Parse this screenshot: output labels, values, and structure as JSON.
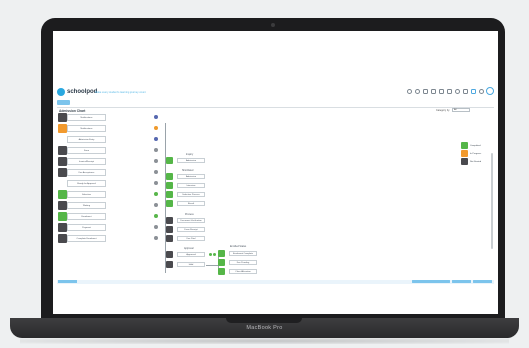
{
  "device": {
    "label": "MacBook Pro"
  },
  "app": {
    "name": "schoolpod",
    "tagline": "Make every student's learning journey count"
  },
  "panel": {
    "title": "Admission Chart",
    "filter_label": "Category by",
    "filter_value": "All"
  },
  "left_column": [
    {
      "label": "Notifications",
      "tile": "dark",
      "dot": "blue"
    },
    {
      "label": "Notifications",
      "tile": "orange",
      "dot": "orange"
    },
    {
      "label": "Admission Entry",
      "tile": "empty",
      "dot": "blue"
    },
    {
      "label": "Form",
      "tile": "dark",
      "dot": "gray"
    },
    {
      "label": "Invoice/Receipt",
      "tile": "dark",
      "dot": "gray"
    },
    {
      "label": "Fee Acceptance",
      "tile": "dark",
      "dot": "gray"
    },
    {
      "label": "Ready for Approval",
      "tile": "empty",
      "dot": "gray"
    },
    {
      "label": "Selection",
      "tile": "green",
      "dot": "green"
    },
    {
      "label": "Waiting",
      "tile": "dark",
      "dot": "gray"
    },
    {
      "label": "Enrolment",
      "tile": "green",
      "dot": "green"
    },
    {
      "label": "Payment",
      "tile": "dark",
      "dot": "gray"
    },
    {
      "label": "Complete Enrolment",
      "tile": "dark",
      "dot": "gray"
    }
  ],
  "groups": {
    "g1": {
      "label": "Inquiry",
      "items": [
        "Admission"
      ]
    },
    "g2": {
      "label": "Shortlisted",
      "items": [
        "Admission",
        "Interview",
        "Selection Process",
        "Result"
      ]
    },
    "g3": {
      "label": "Process",
      "items": [
        "Document Verification",
        "Form Receipt",
        "Fee Paid"
      ]
    },
    "g4": {
      "label": "Approval",
      "items": [
        "Approved",
        "Hold"
      ]
    },
    "g5": {
      "label": "Enrolled Status",
      "items": [
        "Enrolment Complete",
        "Fee Pending",
        "Class Allocation"
      ]
    }
  },
  "legend": [
    {
      "label": "Completed",
      "tile": "green"
    },
    {
      "label": "In Progress",
      "tile": "orange"
    },
    {
      "label": "Not Started",
      "tile": "dark"
    }
  ],
  "footer": {
    "buttons": [
      "Export Report",
      "Print",
      "Share"
    ]
  }
}
